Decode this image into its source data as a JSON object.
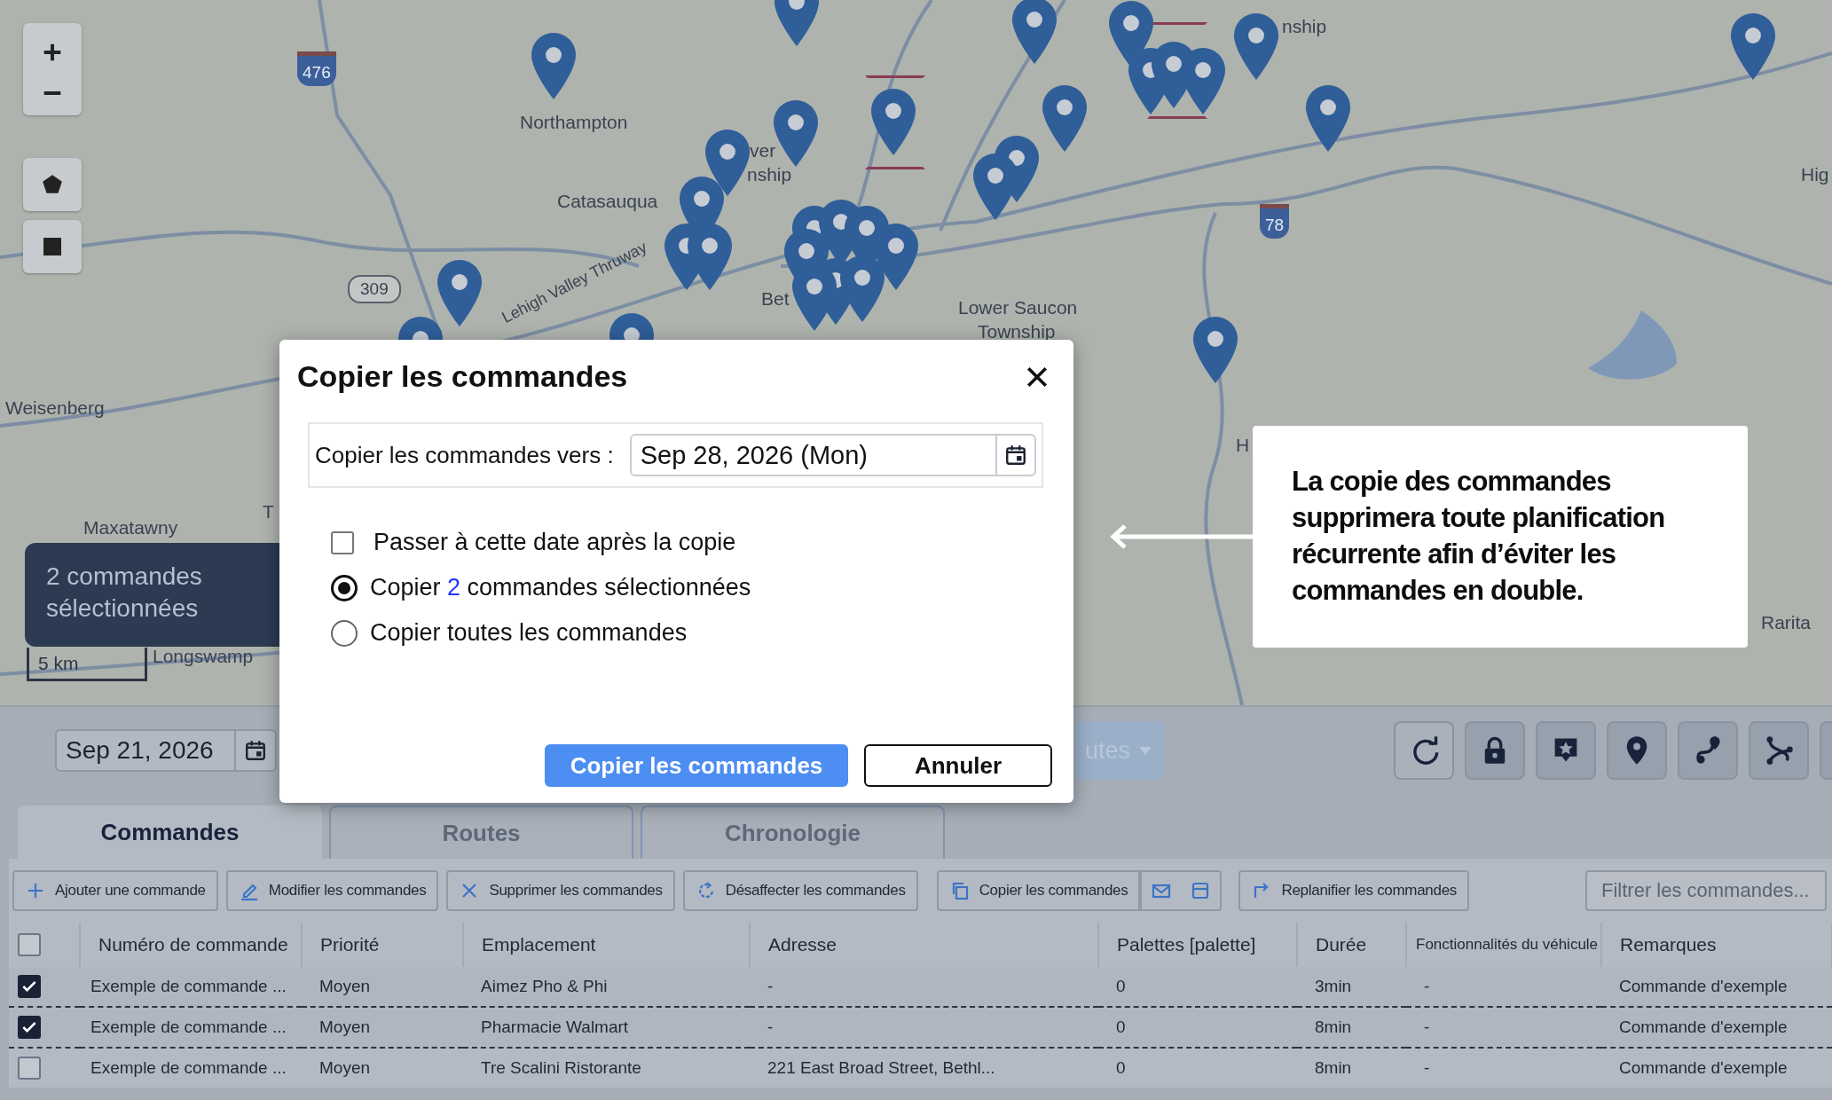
{
  "map": {
    "labels": [
      "Northampton",
      "Catasauqua",
      "ver",
      "nship",
      "Bet",
      "Lehigh Valley Thruway",
      "Lower Saucon",
      "Township",
      "Weisenberg",
      "Maxatawny",
      "T",
      "Longswamp",
      "H",
      "nship",
      "Hig",
      "Rarita"
    ],
    "shields": [
      "476",
      "309",
      "78"
    ],
    "selection_badge": "2 commandes sélectionnées",
    "scale": "5 km"
  },
  "toolbar": {
    "date": "Sep 21, 2026",
    "routes_button": "utes",
    "icon_buttons": [
      {
        "kind": "refresh",
        "on": false
      },
      {
        "kind": "lock",
        "on": true
      },
      {
        "kind": "star-marker",
        "on": true
      },
      {
        "kind": "pin",
        "on": true
      },
      {
        "kind": "route",
        "on": true
      },
      {
        "kind": "branch",
        "on": true
      }
    ]
  },
  "tabs": [
    {
      "label": "Commandes",
      "selected": true
    },
    {
      "label": "Routes",
      "selected": false
    },
    {
      "label": "Chronologie",
      "selected": false
    }
  ],
  "actions": [
    {
      "kind": "add",
      "label": "Ajouter une commande"
    },
    {
      "kind": "edit",
      "label": "Modifier les commandes"
    },
    {
      "kind": "delete",
      "label": "Supprimer les commandes"
    },
    {
      "kind": "unassign",
      "label": "Désaffecter les commandes"
    },
    {
      "kind": "copy",
      "label": "Copier les commandes"
    },
    {
      "kind": "mail"
    },
    {
      "kind": "window"
    },
    {
      "kind": "reschedule",
      "label": "Replanifier les commandes"
    }
  ],
  "filter": {
    "placeholder": "Filtrer les commandes..."
  },
  "table": {
    "select_all": {
      "checked": false
    },
    "columns": [
      "Numéro de commande",
      "Priorité",
      "Emplacement",
      "Adresse",
      "Palettes [palette]",
      "Durée",
      "Fonctionnalités du véhicule",
      "Remarques"
    ],
    "rows": [
      {
        "selected": true,
        "cells": [
          "Exemple de commande ...",
          "Moyen",
          "Aimez Pho & Phi",
          "-",
          "0",
          "3min",
          "-",
          "Commande d'exemple"
        ]
      },
      {
        "selected": true,
        "cells": [
          "Exemple de commande ...",
          "Moyen",
          "Pharmacie Walmart",
          "-",
          "0",
          "8min",
          "-",
          "Commande d'exemple"
        ]
      },
      {
        "selected": false,
        "cells": [
          "Exemple de commande ...",
          "Moyen",
          "Tre Scalini Ristorante",
          "221 East Broad Street, Bethl...",
          "0",
          "8min",
          "-",
          "Commande d'exemple"
        ]
      }
    ]
  },
  "dialog": {
    "title": "Copier les commandes",
    "date_label": "Copier les commandes vers :",
    "date_value": "Sep 28, 2026 (Mon)",
    "options": [
      {
        "kind": "checkbox",
        "checked": false,
        "label_parts": [
          "Passer à cette date après la copie"
        ]
      },
      {
        "kind": "radio",
        "selected": true,
        "label_parts": [
          "Copier ",
          "2",
          " commandes sélectionnées"
        ]
      },
      {
        "kind": "radio",
        "selected": false,
        "label_parts": [
          "Copier toutes les commandes"
        ]
      }
    ],
    "primary_button": "Copier les commandes",
    "cancel_button": "Annuler"
  },
  "callout": {
    "text": "La copie des commandes supprimera toute planification récurrente afin d’éviter les commandes en double."
  }
}
